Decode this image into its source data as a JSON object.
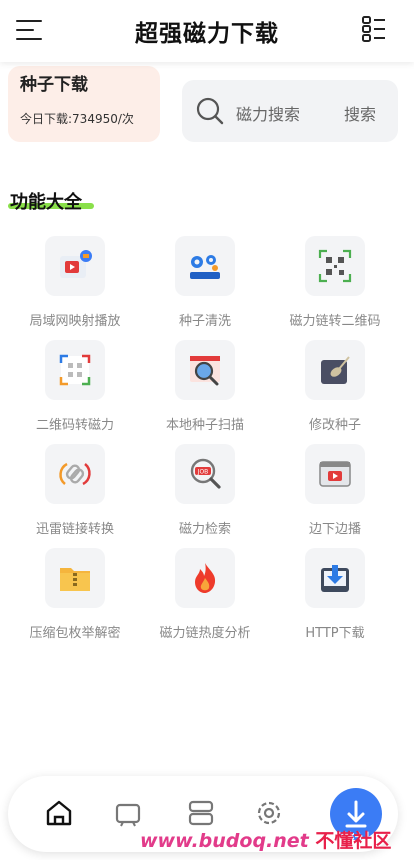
{
  "header": {
    "title": "超强磁力下载"
  },
  "seed_card": {
    "title": "种子下载",
    "today_label": "今日下载:734950/次"
  },
  "search_card": {
    "label": "磁力搜索",
    "button": "搜索"
  },
  "section": {
    "title": "功能大全"
  },
  "features": [
    {
      "label": "局域网映射播放",
      "icon": "lan-video-icon"
    },
    {
      "label": "种子清洗",
      "icon": "gears-icon"
    },
    {
      "label": "磁力链转二维码",
      "icon": "qr-code-icon"
    },
    {
      "label": "二维码转磁力",
      "icon": "qr-scan-icon"
    },
    {
      "label": "本地种子扫描",
      "icon": "magnifier-scan-icon"
    },
    {
      "label": "修改种子",
      "icon": "edit-tablet-icon"
    },
    {
      "label": "迅雷链接转换",
      "icon": "chain-link-icon"
    },
    {
      "label": "磁力检索",
      "icon": "job-search-icon"
    },
    {
      "label": "边下边播",
      "icon": "video-player-icon"
    },
    {
      "label": "压缩包枚举解密",
      "icon": "zip-folder-icon"
    },
    {
      "label": "磁力链热度分析",
      "icon": "fire-icon"
    },
    {
      "label": "HTTP下载",
      "icon": "download-tray-icon"
    }
  ],
  "watermark": {
    "site": "www.budoq.net",
    "cn": "不懂社区"
  },
  "colors": {
    "accent": "#3b7cf5",
    "underline": "#8ae04a",
    "seed_bg": "#fdeee8"
  }
}
